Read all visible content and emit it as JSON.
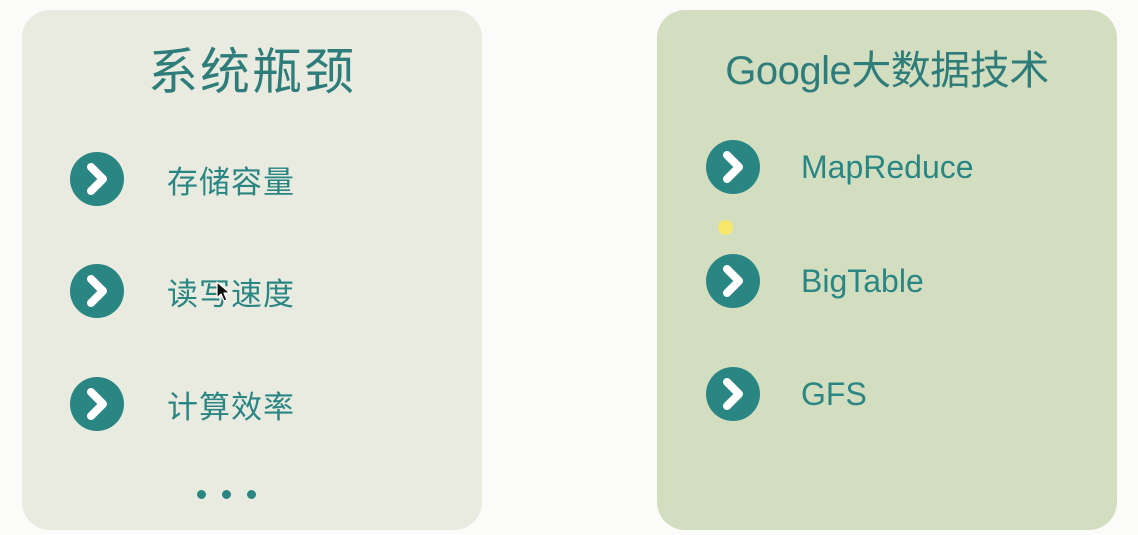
{
  "left_panel": {
    "title": "系统瓶颈",
    "items": [
      {
        "label": "存储容量",
        "icon": "chevron-right-circle-icon"
      },
      {
        "label": "读写速度",
        "icon": "chevron-right-circle-icon"
      },
      {
        "label": "计算效率",
        "icon": "chevron-right-circle-icon"
      }
    ],
    "ellipsis": "..."
  },
  "right_panel": {
    "title": "Google大数据技术",
    "items": [
      {
        "label": "MapReduce",
        "icon": "chevron-right-circle-icon"
      },
      {
        "label": "BigTable",
        "icon": "chevron-right-circle-icon"
      },
      {
        "label": "GFS",
        "icon": "chevron-right-circle-icon"
      }
    ]
  },
  "colors": {
    "page_background": "#fbfbf9",
    "left_panel_background": "#e9ebe0",
    "right_panel_background": "#d3dec1",
    "accent_teal": "#2a8683",
    "title_teal": "#2f7d7a",
    "pointer_highlight": "#f5e86a"
  }
}
